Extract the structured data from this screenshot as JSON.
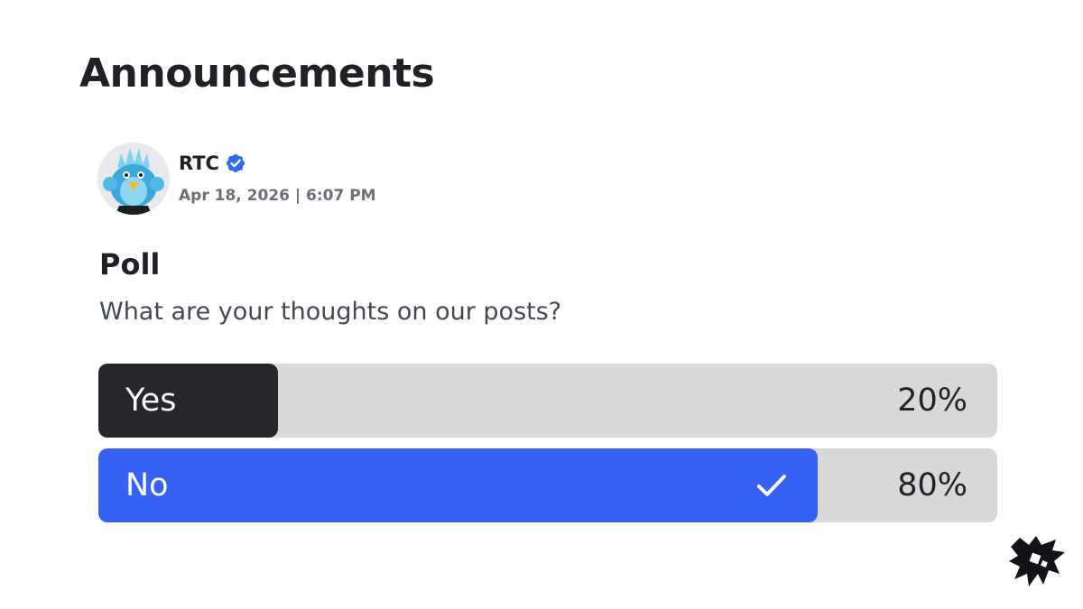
{
  "header": {
    "title": "Announcements"
  },
  "post": {
    "author": {
      "name": "RTC",
      "verified": true,
      "avatar_icon": "penguin-avatar"
    },
    "timestamp": "Apr 18, 2026 | 6:07 PM"
  },
  "poll": {
    "label": "Poll",
    "question": "What are your thoughts on our posts?",
    "options": [
      {
        "label": "Yes",
        "percent_text": "20%",
        "value": 20,
        "selected": false,
        "fill_color": "#25272c"
      },
      {
        "label": "No",
        "percent_text": "80%",
        "value": 80,
        "selected": true,
        "fill_color": "#3661f5"
      }
    ]
  },
  "colors": {
    "track": "#d8d8d8",
    "verified_badge": "#2f6cf6",
    "title_text": "#1f2126",
    "muted_text": "#6b6f78"
  },
  "icons": {
    "verified": "verified-check-icon",
    "selected": "check-icon",
    "brand": "bird-logo-icon"
  }
}
